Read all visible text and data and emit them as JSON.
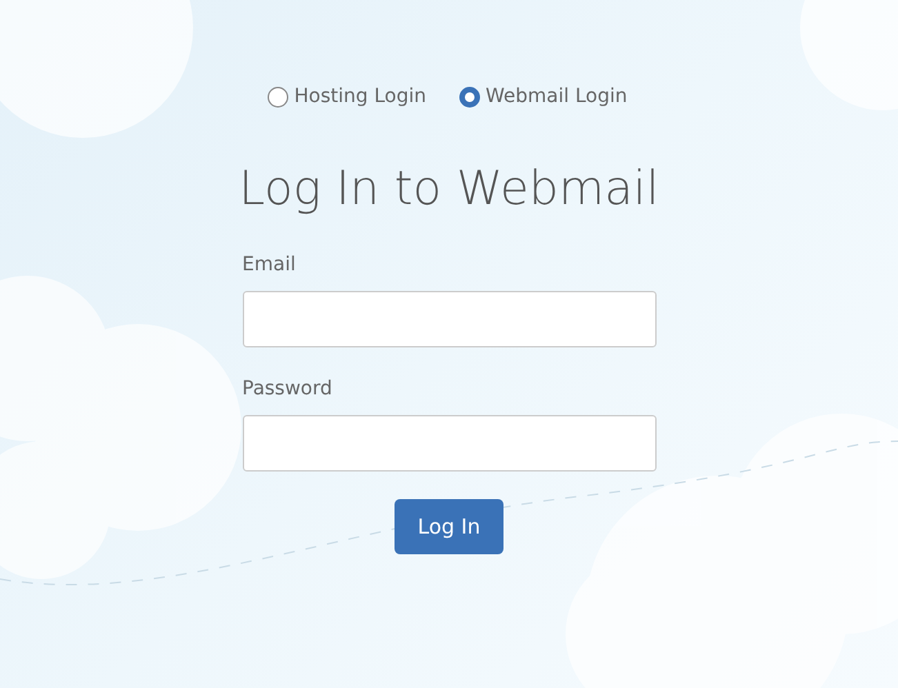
{
  "login_types": [
    {
      "label": "Hosting Login",
      "selected": false
    },
    {
      "label": "Webmail Login",
      "selected": true
    }
  ],
  "heading": "Log In to Webmail",
  "fields": [
    {
      "label": "Email"
    },
    {
      "label": "Password"
    }
  ],
  "submit_button": "Log In"
}
